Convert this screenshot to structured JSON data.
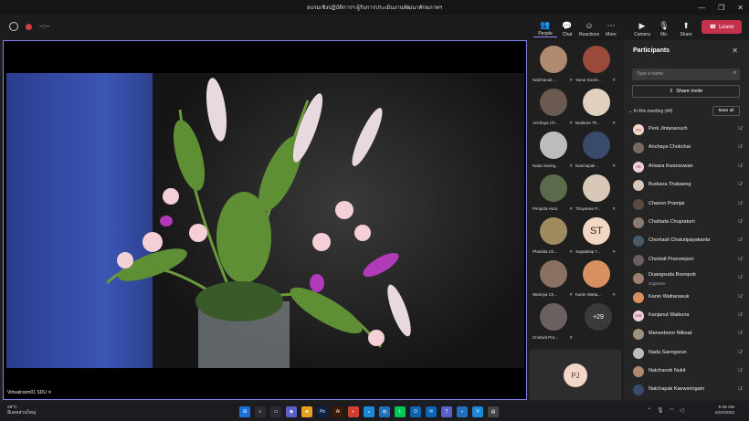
{
  "window": {
    "title": "อบรมเชิงปฏิบัติการฯ ผู้รับการประเมินงานพัฒนาศักยภาพฯ",
    "controls": [
      "—",
      "❐",
      "✕"
    ]
  },
  "toolbar": {
    "timer": "--:--",
    "buttons": [
      {
        "label": "People",
        "glyph": "👥"
      },
      {
        "label": "Chat",
        "glyph": "💬"
      },
      {
        "label": "Reactions",
        "glyph": "☺"
      },
      {
        "label": "More",
        "glyph": "⋯"
      },
      {
        "label": "Camera",
        "glyph": "▶"
      },
      {
        "label": "Mic",
        "glyph": "🎙"
      },
      {
        "label": "Share",
        "glyph": "⬆"
      }
    ],
    "leave_label": "Leave"
  },
  "stage": {
    "label": "Virtualroom01 SDU"
  },
  "grid": {
    "tiles": [
      {
        "name": "Natchanok ...",
        "color": "#b08a70"
      },
      {
        "name": "Yanut Soont...",
        "color": "#9a4a3a"
      },
      {
        "name": "Anchaya Ch...",
        "color": "#6a5a50"
      },
      {
        "name": "Budsara Th...",
        "color": "#e0d0c0"
      },
      {
        "name": "Nada Saeng...",
        "color": "#bdbdbd"
      },
      {
        "name": "Natchapak ...",
        "color": "#3a4a6a"
      },
      {
        "name": "Pimpida Hora",
        "color": "#5a6a4a"
      },
      {
        "name": "Thayanee P...",
        "color": "#d8c8b8"
      },
      {
        "name": "Phanitta Ch...",
        "color": "#a08a60"
      },
      {
        "name": "Supadetip T...",
        "color": "#f3d7c5",
        "initials": "ST"
      },
      {
        "name": "Warinya Ch...",
        "color": "#8a7060"
      },
      {
        "name": "Kanin Watta...",
        "color": "#d89060"
      },
      {
        "name": "Chotiwit Pra...",
        "color": "#6a6060"
      }
    ],
    "more_count": "+29"
  },
  "self": {
    "initials": "PJ"
  },
  "panel": {
    "title": "Participants",
    "search_placeholder": "Type a name",
    "share_invite": "Share invite",
    "in_meeting": "In this meeting (44)",
    "mute_all": "Mute all",
    "participants": [
      {
        "name": "Perk Jintananuch",
        "initials": "PJ",
        "color": "#f2d6c9"
      },
      {
        "name": "Anchaya Chokchai",
        "initials": "",
        "color": "#7a6a60"
      },
      {
        "name": "Arisara Kwansuwan",
        "initials": "AK",
        "color": "#f0cfd8"
      },
      {
        "name": "Budsara Thakaeng",
        "initials": "",
        "color": "#d8c8b8"
      },
      {
        "name": "Chanon Pramjai",
        "initials": "",
        "color": "#5a4a40"
      },
      {
        "name": "Chatlada Chupratum",
        "initials": "",
        "color": "#8a7a70"
      },
      {
        "name": "Chonlasit Chatutipayakanta",
        "initials": "",
        "color": "#4a5a6a"
      },
      {
        "name": "Chotiwit Pranompon",
        "initials": "",
        "color": "#6a6060"
      },
      {
        "name": "Duangsuda Boonpob",
        "initials": "",
        "color": "#9a8070",
        "sub": "Organizer"
      },
      {
        "name": "Kanin Wattanasuk",
        "initials": "",
        "color": "#d89060"
      },
      {
        "name": "Kanjanut Waikuna",
        "initials": "KW",
        "color": "#f0cfd8"
      },
      {
        "name": "Maneeboon Nilkeat",
        "initials": "",
        "color": "#a09080"
      },
      {
        "name": "Nada Saengarun",
        "initials": "",
        "color": "#bdbdbd"
      },
      {
        "name": "Natchanok Nukit",
        "initials": "",
        "color": "#b08a70"
      },
      {
        "name": "Natchapak Kaewsringam",
        "initials": "",
        "color": "#3a4a6a"
      }
    ]
  },
  "taskbar": {
    "temp": "29°C",
    "weather_desc": "มีแดดส่วนใหญ่",
    "time": "9:49 AM",
    "date": "4/22/2022",
    "apps": [
      {
        "g": "⊞",
        "c": "#1f6fd8"
      },
      {
        "g": "⌕",
        "c": "#2b2b30"
      },
      {
        "g": "▭",
        "c": "#2b2b30"
      },
      {
        "g": "◉",
        "c": "#5b5fc7"
      },
      {
        "g": "▰",
        "c": "#e8a020"
      },
      {
        "g": "Ps",
        "c": "#0b2240"
      },
      {
        "g": "Ai",
        "c": "#3a1a00"
      },
      {
        "g": "◐",
        "c": "#d04030"
      },
      {
        "g": "◒",
        "c": "#1a8ad8"
      },
      {
        "g": "◍",
        "c": "#2070c0"
      },
      {
        "g": "L",
        "c": "#06c755"
      },
      {
        "g": "O",
        "c": "#0a64b0"
      },
      {
        "g": "✉",
        "c": "#0a64b0"
      },
      {
        "g": "T",
        "c": "#5b5fc7"
      },
      {
        "g": "◗",
        "c": "#2070c0"
      },
      {
        "g": "V",
        "c": "#1a8ad8"
      },
      {
        "g": "▤",
        "c": "#444"
      }
    ]
  }
}
